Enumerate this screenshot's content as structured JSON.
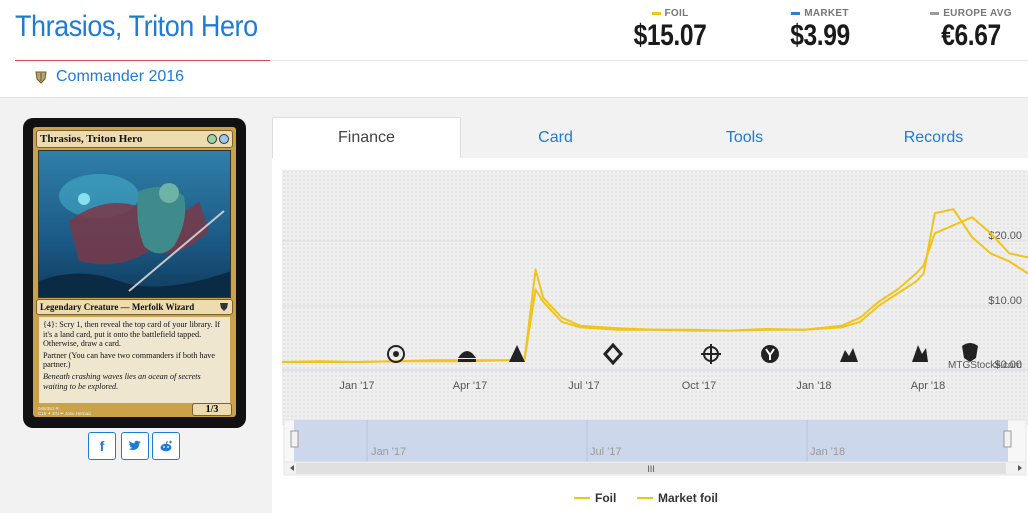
{
  "header": {
    "title": "Thrasios, Triton Hero",
    "set_name": "Commander 2016"
  },
  "prices": [
    {
      "label": "FOIL",
      "value": "$15.07",
      "color": "#f0c419"
    },
    {
      "label": "MARKET",
      "value": "$3.99",
      "color": "#2b82c9"
    },
    {
      "label": "EUROPE AVG",
      "value": "€6.67",
      "color": "#9a9a9a"
    }
  ],
  "card": {
    "name": "Thrasios, Triton Hero",
    "type_line": "Legendary Creature — Merfolk Wizard",
    "rules_text": "{4}: Scry 1, then reveal the top card of your library. If it's a land card, put it onto the battlefield tapped. Otherwise, draw a card.",
    "partner_text": "Partner (You can have two commanders if both have partner.)",
    "flavor_text": "Beneath crashing waves lies an ocean of secrets waiting to be explored.",
    "pt": "1/3",
    "footer_1": "046/351 R",
    "footer_2": "C16 ✦ EN ✒ Josu Hernaiz",
    "copyright": "™ & © 2016 Wizards of the Coast"
  },
  "social": {
    "facebook": "f",
    "twitter": "t",
    "reddit": "r"
  },
  "tabs": [
    "Finance",
    "Card",
    "Tools",
    "Records"
  ],
  "chart_data": {
    "type": "line",
    "x_axis_labels": [
      "Jan '17",
      "Apr '17",
      "Jul '17",
      "Oct '17",
      "Jan '18",
      "Apr '18"
    ],
    "y_axis_labels": [
      "$20.00",
      "$10.00",
      "$0.00"
    ],
    "ylim": [
      0,
      24
    ],
    "watermark": "MTGStocks.com",
    "navigator_labels": [
      "Jan '17",
      "Jul '17",
      "Jan '18"
    ],
    "navigator_scroll_handle": "III",
    "series": [
      {
        "name": "Foil",
        "color": "#f0c419",
        "x": [
          0,
          10,
          20,
          30,
          40,
          50,
          60,
          65,
          68,
          70,
          75,
          80,
          90,
          100,
          110,
          120,
          130,
          140,
          150,
          155,
          160,
          165,
          170,
          172,
          175,
          180,
          185,
          190,
          195,
          200
        ],
        "y": [
          1.0,
          1.0,
          1.0,
          1.1,
          1.1,
          1.1,
          1.2,
          1.2,
          12.5,
          9.0,
          6.5,
          5.5,
          5.2,
          5.0,
          5.0,
          4.9,
          5.0,
          5.0,
          5.3,
          6.0,
          8.0,
          9.5,
          11.0,
          12.0,
          19.5,
          20.0,
          16.5,
          14.5,
          13.5,
          12.0
        ]
      },
      {
        "name": "Market foil",
        "color": "#f0c419",
        "x": [
          0,
          10,
          20,
          30,
          40,
          50,
          60,
          65,
          68,
          70,
          75,
          80,
          90,
          100,
          110,
          120,
          130,
          140,
          150,
          155,
          160,
          165,
          170,
          172,
          175,
          180,
          185,
          190,
          195,
          200
        ],
        "y": [
          1.0,
          1.1,
          1.0,
          1.1,
          1.2,
          1.2,
          1.2,
          1.3,
          10.0,
          8.5,
          6.0,
          5.3,
          5.0,
          5.0,
          4.9,
          4.9,
          5.1,
          5.0,
          5.5,
          6.5,
          8.5,
          10.0,
          12.0,
          13.0,
          17.0,
          18.0,
          19.0,
          17.0,
          14.5,
          14.0
        ]
      }
    ],
    "event_icons": [
      "set-icon-1",
      "set-icon-2",
      "set-icon-3",
      "set-icon-4",
      "set-icon-5",
      "set-icon-6",
      "set-icon-7",
      "set-icon-8",
      "set-icon-9"
    ]
  }
}
